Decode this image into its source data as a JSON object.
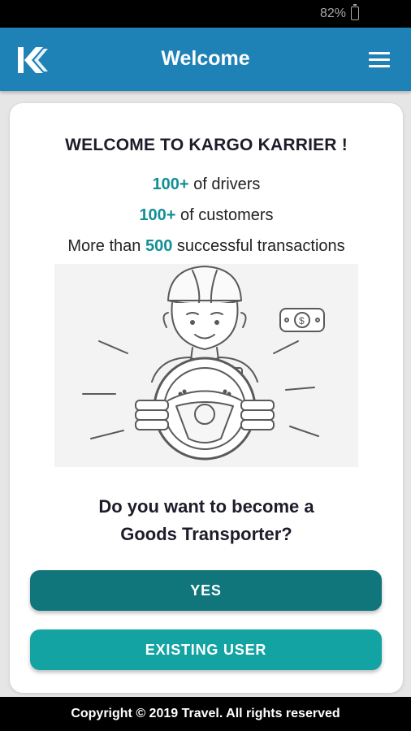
{
  "status_bar": {
    "battery": "82%"
  },
  "app_bar": {
    "title": "Welcome"
  },
  "card": {
    "heading": "WELCOME TO KARGO KARRIER !",
    "stats": [
      {
        "highlight": "100+",
        "text": " of drivers"
      },
      {
        "highlight": "100+",
        "text": " of customers"
      },
      {
        "prefix": "More than ",
        "highlight": "500",
        "text": " successful transactions"
      }
    ],
    "question_line1": "Do you want to become a",
    "question_line2": "Goods Transporter?",
    "yes_label": "YES",
    "existing_label": "EXISTING USER"
  },
  "footer": {
    "text": "Copyright © 2019 Travel. All rights reserved"
  },
  "colors": {
    "app_bar": "#1f82b6",
    "accent_text": "#128f96",
    "yes_button": "#11767c",
    "existing_button": "#14a3a3"
  },
  "icons": [
    "kargo-logo-icon",
    "hamburger-menu-icon",
    "battery-icon",
    "driver-illustration"
  ]
}
